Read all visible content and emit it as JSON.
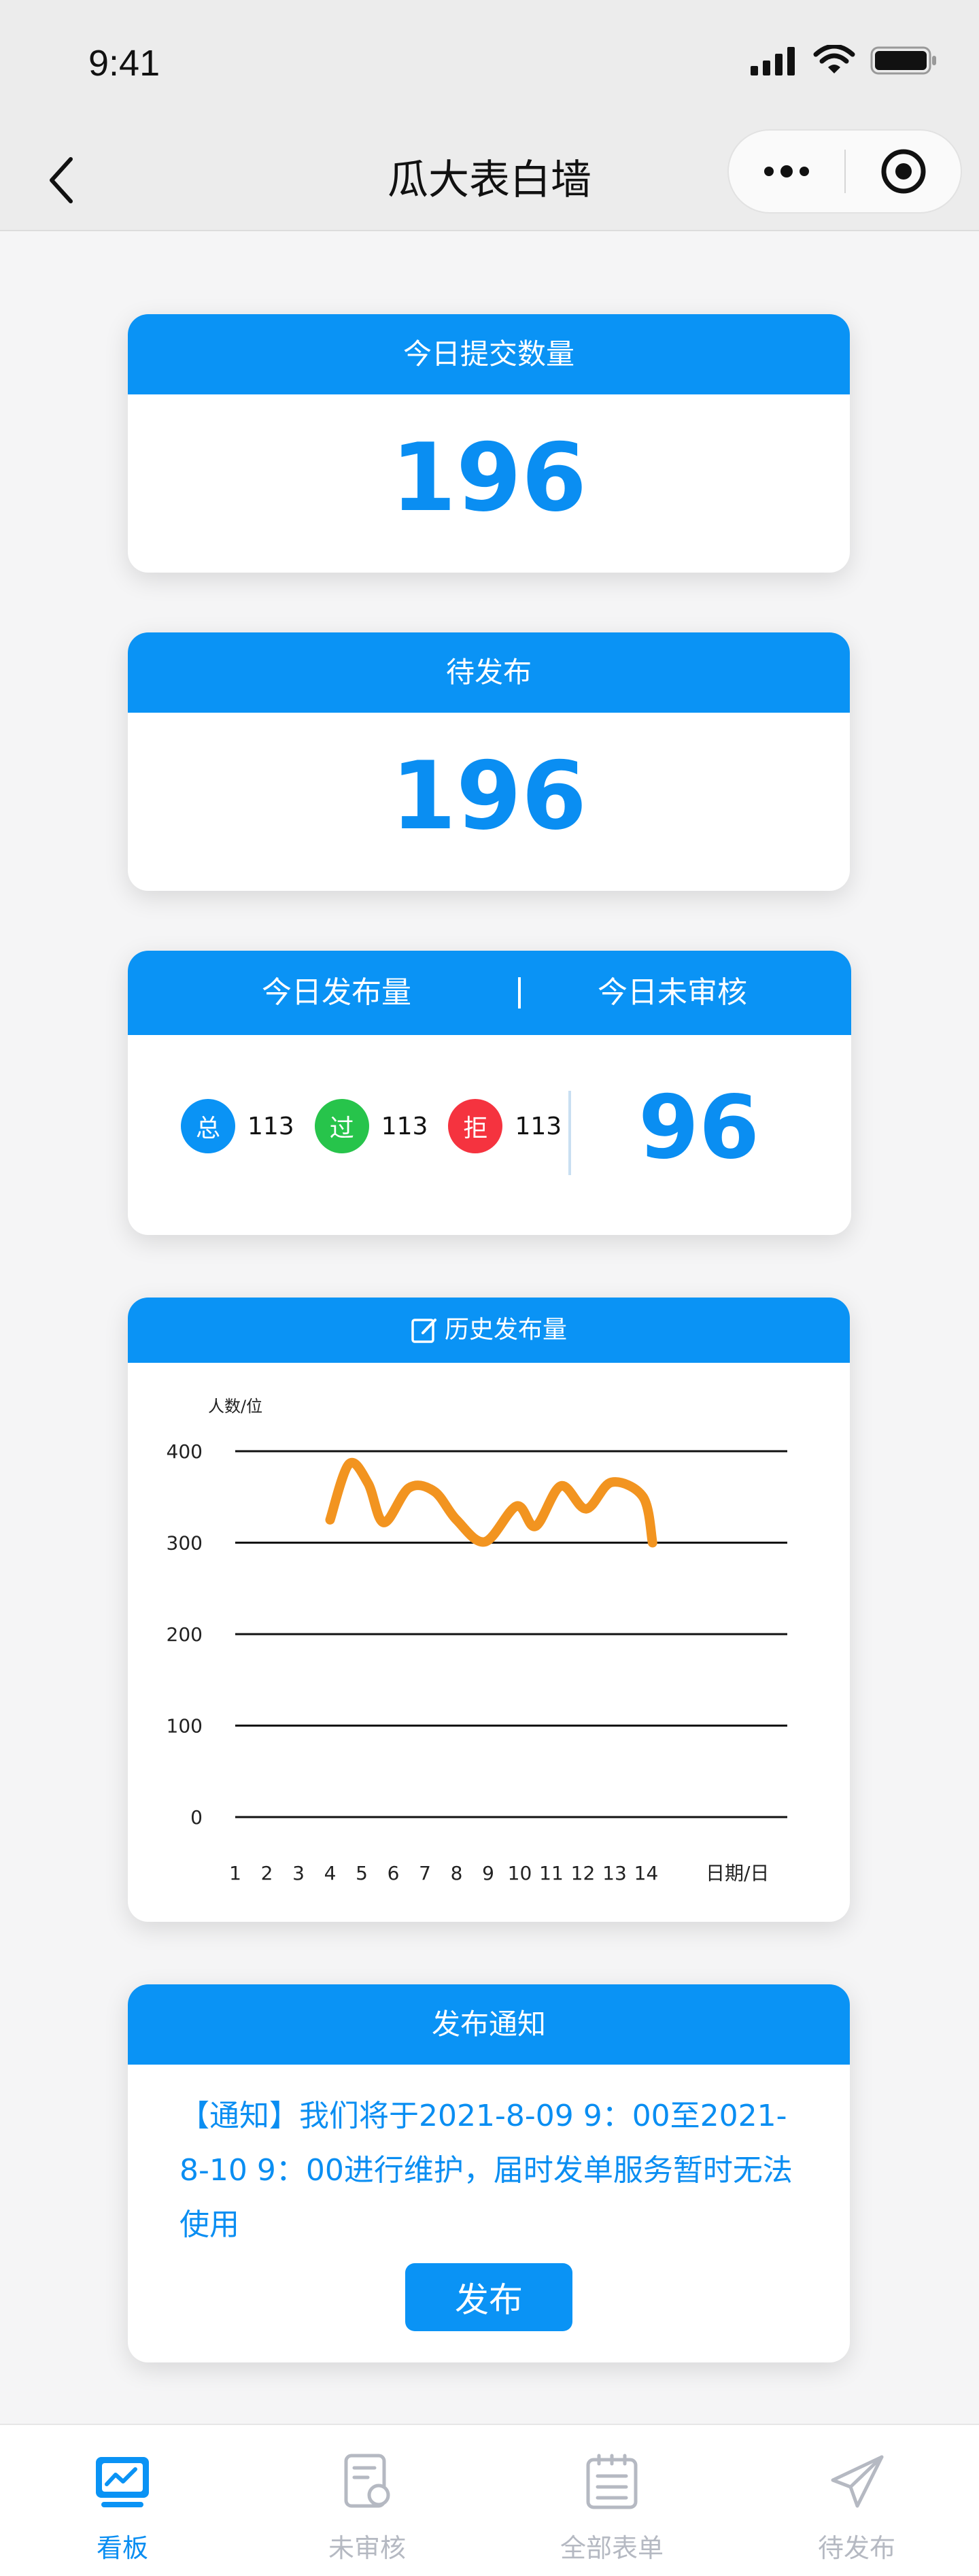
{
  "status_bar": {
    "time": "9:41"
  },
  "nav": {
    "title": "瓜大表白墙"
  },
  "colors": {
    "primary": "#0a93f5",
    "number": "#0a8ef2",
    "total": "#0a93f5",
    "pass": "#27c44b",
    "reject": "#f5333f",
    "line": "#f29420",
    "inactive": "#b5b9c2"
  },
  "cards": {
    "today_submissions": {
      "title": "今日提交数量",
      "value": "196"
    },
    "to_publish": {
      "title": "待发布",
      "value": "196"
    },
    "today_stats": {
      "title_left": "今日发布量",
      "title_right": "今日未审核",
      "stats": [
        {
          "badge": "总",
          "value": "113",
          "color": "#0a93f5"
        },
        {
          "badge": "过",
          "value": "113",
          "color": "#27c44b"
        },
        {
          "badge": "拒",
          "value": "113",
          "color": "#f5333f"
        }
      ],
      "pending": "96"
    },
    "history": {
      "title": "历史发布量"
    },
    "notice": {
      "title": "发布通知",
      "text": "【通知】我们将于2021-8-09 9：00至2021-8-10 9：00进行维护，届时发单服务暂时无法使用",
      "button": "发布"
    }
  },
  "chart_data": {
    "type": "line",
    "title": "历史发布量",
    "ylabel": "人数/位",
    "xlabel": "日期/日",
    "x": [
      1,
      2,
      3,
      4,
      5,
      6,
      7,
      8,
      9,
      10,
      11,
      12,
      13,
      14
    ],
    "y_ticks": [
      0,
      100,
      200,
      300,
      400
    ],
    "ylim": [
      0,
      400
    ],
    "grid": true,
    "series": [
      {
        "points": [
          [
            4,
            325
          ],
          [
            4.6,
            386
          ],
          [
            5.2,
            365
          ],
          [
            5.7,
            322
          ],
          [
            6.5,
            360
          ],
          [
            7.3,
            356
          ],
          [
            8.0,
            325
          ],
          [
            8.9,
            301
          ],
          [
            9.9,
            340
          ],
          [
            10.5,
            318
          ],
          [
            11.3,
            362
          ],
          [
            12.1,
            337
          ],
          [
            12.9,
            366
          ],
          [
            13.9,
            350
          ],
          [
            14.2,
            300
          ]
        ],
        "color": "#f29420"
      }
    ]
  },
  "tabs": [
    {
      "label": "看板",
      "icon": "dashboard-icon",
      "active": true
    },
    {
      "label": "未审核",
      "icon": "review-document-icon",
      "active": false
    },
    {
      "label": "全部表单",
      "icon": "form-list-icon",
      "active": false
    },
    {
      "label": "待发布",
      "icon": "send-icon",
      "active": false
    }
  ]
}
